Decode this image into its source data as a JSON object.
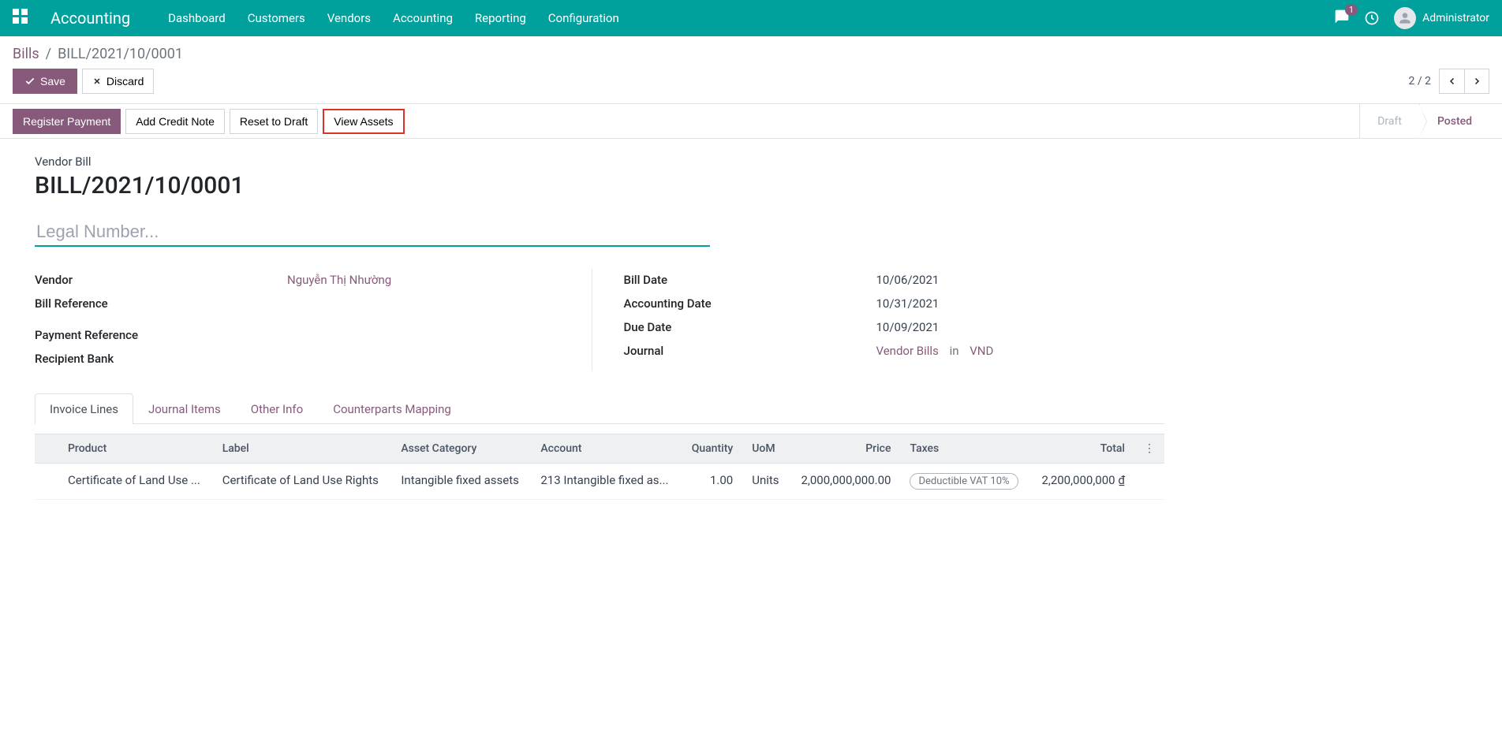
{
  "navbar": {
    "app_title": "Accounting",
    "menu": [
      "Dashboard",
      "Customers",
      "Vendors",
      "Accounting",
      "Reporting",
      "Configuration"
    ],
    "notification_count": "1",
    "user_name": "Administrator"
  },
  "breadcrumb": {
    "root": "Bills",
    "current": "BILL/2021/10/0001"
  },
  "buttons": {
    "save": "Save",
    "discard": "Discard",
    "register_payment": "Register Payment",
    "add_credit_note": "Add Credit Note",
    "reset_to_draft": "Reset to Draft",
    "view_assets": "View Assets"
  },
  "pager": {
    "text": "2 / 2"
  },
  "status": {
    "draft": "Draft",
    "posted": "Posted"
  },
  "form": {
    "type_label": "Vendor Bill",
    "title": "BILL/2021/10/0001",
    "legal_placeholder": "Legal Number...",
    "left": {
      "vendor_label": "Vendor",
      "vendor_value": "Nguyễn Thị Nhường",
      "bill_ref_label": "Bill Reference",
      "bill_ref_value": "",
      "payment_ref_label": "Payment Reference",
      "payment_ref_value": "",
      "recipient_bank_label": "Recipient Bank",
      "recipient_bank_value": ""
    },
    "right": {
      "bill_date_label": "Bill Date",
      "bill_date_value": "10/06/2021",
      "accounting_date_label": "Accounting Date",
      "accounting_date_value": "10/31/2021",
      "due_date_label": "Due Date",
      "due_date_value": "10/09/2021",
      "journal_label": "Journal",
      "journal_value": "Vendor Bills",
      "journal_in": "in",
      "journal_currency": "VND"
    }
  },
  "tabs": {
    "invoice_lines": "Invoice Lines",
    "journal_items": "Journal Items",
    "other_info": "Other Info",
    "counterparts": "Counterparts Mapping"
  },
  "table": {
    "headers": {
      "product": "Product",
      "label": "Label",
      "asset_category": "Asset Category",
      "account": "Account",
      "quantity": "Quantity",
      "uom": "UoM",
      "price": "Price",
      "taxes": "Taxes",
      "total": "Total"
    },
    "row": {
      "product": "Certificate of Land Use ...",
      "label": "Certificate of Land Use Rights",
      "asset_category": "Intangible fixed assets",
      "account": "213 Intangible fixed as...",
      "quantity": "1.00",
      "uom": "Units",
      "price": "2,000,000,000.00",
      "taxes": "Deductible VAT 10%",
      "total": "2,200,000,000 ₫"
    }
  }
}
